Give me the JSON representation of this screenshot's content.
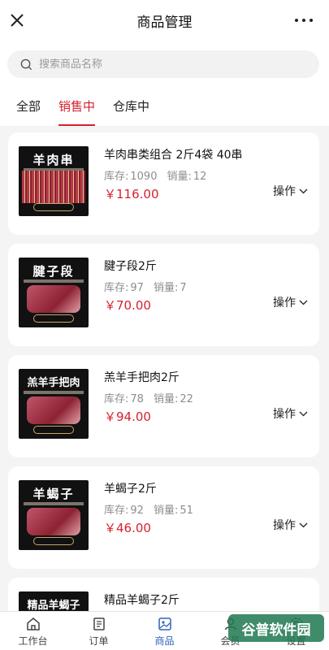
{
  "header": {
    "title": "商品管理",
    "close_icon": "close-icon",
    "more_icon": "more-dots-icon"
  },
  "search": {
    "placeholder": "搜索商品名称",
    "value": ""
  },
  "tabs": [
    {
      "label": "全部",
      "active": false
    },
    {
      "label": "销售中",
      "active": true
    },
    {
      "label": "仓库中",
      "active": false
    }
  ],
  "products": [
    {
      "name": "羊肉串类组合 2斤4袋 40串",
      "stock_label": "库存:",
      "stock": "1090",
      "sales_label": "销量:",
      "sales": "12",
      "price": "￥116.00",
      "action": "操作",
      "image_title": "羊肉串"
    },
    {
      "name": "腱子段2斤",
      "stock_label": "库存:",
      "stock": "97",
      "sales_label": "销量:",
      "sales": "7",
      "price": "￥70.00",
      "action": "操作",
      "image_title": "腱子段"
    },
    {
      "name": "羔羊手把肉2斤",
      "stock_label": "库存:",
      "stock": "78",
      "sales_label": "销量:",
      "sales": "22",
      "price": "￥94.00",
      "action": "操作",
      "image_title": "羔羊手把肉"
    },
    {
      "name": "羊蝎子2斤",
      "stock_label": "库存:",
      "stock": "92",
      "sales_label": "销量:",
      "sales": "51",
      "price": "￥46.00",
      "action": "操作",
      "image_title": "羊蝎子"
    },
    {
      "name": "精品羊蝎子2斤",
      "image_title": "精品羊蝎子"
    }
  ],
  "bottom_nav": [
    {
      "label": "工作台",
      "icon": "home-icon",
      "active": false
    },
    {
      "label": "订单",
      "icon": "order-icon",
      "active": false
    },
    {
      "label": "商品",
      "icon": "product-icon",
      "active": true
    },
    {
      "label": "会员",
      "icon": "member-icon",
      "active": false
    },
    {
      "label": "设置",
      "icon": "settings-icon",
      "active": false
    }
  ],
  "watermark": {
    "text": "谷普软件园"
  },
  "colors": {
    "accent": "#d7202f",
    "nav_active": "#2e63b8"
  }
}
